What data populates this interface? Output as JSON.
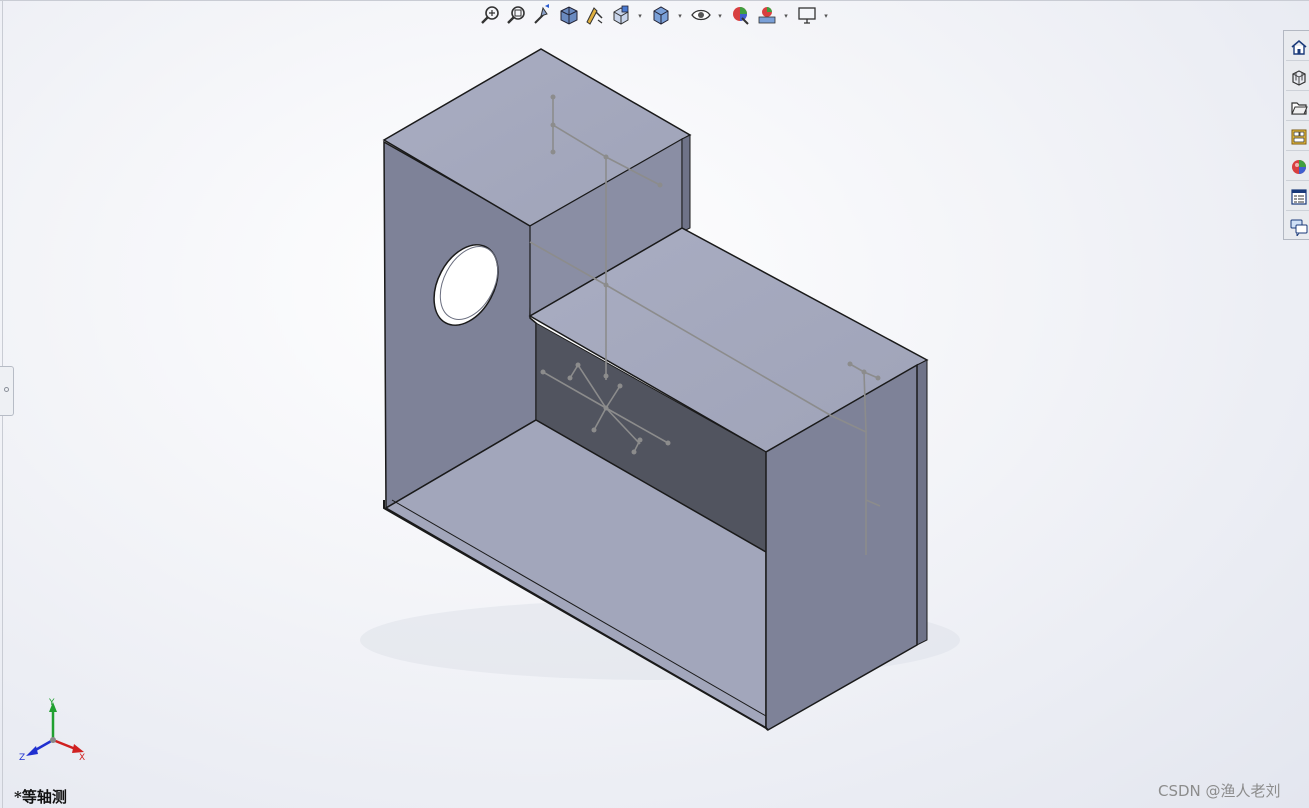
{
  "viewport": {
    "view_label": "*等轴测",
    "watermark": "CSDN @渔人老刘"
  },
  "heads_up_toolbar": {
    "buttons": [
      {
        "name": "zoom-to-fit-icon"
      },
      {
        "name": "zoom-to-area-icon"
      },
      {
        "name": "previous-view-icon"
      },
      {
        "name": "section-view-icon"
      },
      {
        "name": "dynamic-annotation-views-icon"
      },
      {
        "name": "view-orientation-icon"
      },
      {
        "name": "display-style-icon"
      },
      {
        "name": "hide-show-items-icon"
      },
      {
        "name": "edit-appearance-icon"
      },
      {
        "name": "apply-scene-icon"
      },
      {
        "name": "view-settings-icon"
      }
    ]
  },
  "task_pane": {
    "tabs": [
      {
        "name": "home-icon"
      },
      {
        "name": "design-library-icon"
      },
      {
        "name": "file-explorer-icon"
      },
      {
        "name": "view-palette-icon"
      },
      {
        "name": "appearances-scenes-icon"
      },
      {
        "name": "custom-properties-icon"
      },
      {
        "name": "forum-icon"
      }
    ]
  },
  "triad": {
    "x_label": "X",
    "y_label": "Y",
    "z_label": "Z",
    "colors": {
      "x": "#d02020",
      "y": "#20a030",
      "z": "#2030d0"
    }
  },
  "model": {
    "colors": {
      "top_face": "#a4a8bd",
      "dark_face": "#7d8197",
      "inner_shadow": "#51545f",
      "edge": "#1a1a1a",
      "sketch": "#8c8c8c"
    }
  }
}
